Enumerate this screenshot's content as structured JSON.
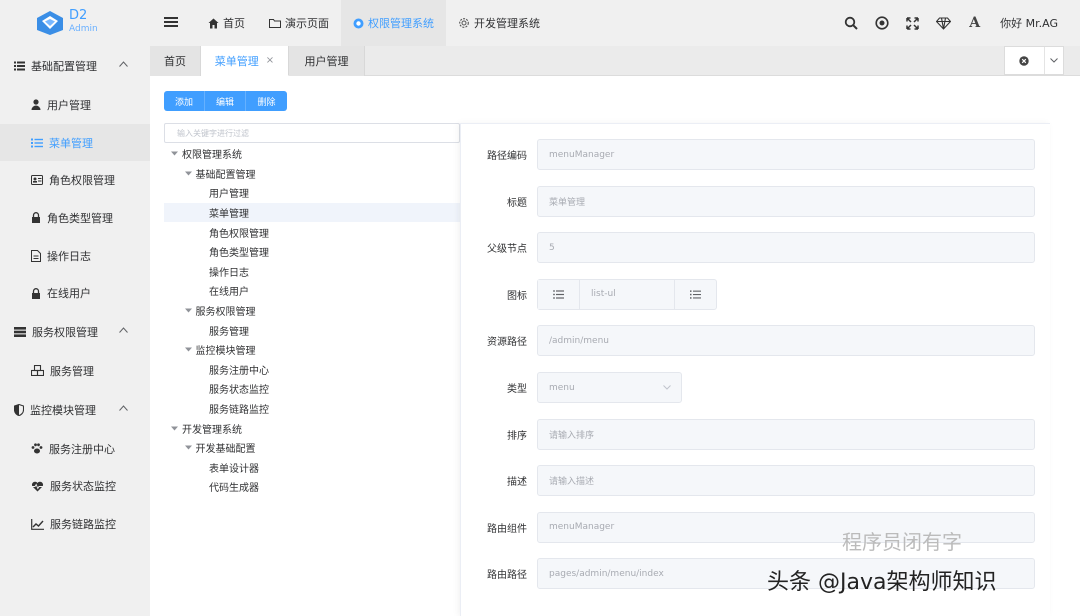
{
  "app": {
    "name": "D2",
    "subtitle": "Admin"
  },
  "topnav": [
    {
      "label": "首页",
      "icon": "home-icon"
    },
    {
      "label": "演示页面",
      "icon": "folder-icon"
    },
    {
      "label": "权限管理系统",
      "icon": "shield-icon",
      "active": true
    },
    {
      "label": "开发管理系统",
      "icon": "gear-icon"
    }
  ],
  "tools": [
    "search-icon",
    "record-icon",
    "fullscreen-icon",
    "diamond-icon",
    "font-icon"
  ],
  "font_tool_label": "A",
  "greeting": "你好 Mr.AG",
  "sidebar": {
    "groups": [
      {
        "label": "基础配置管理",
        "icon": "list-icon",
        "items": [
          {
            "label": "用户管理",
            "icon": "user-icon"
          },
          {
            "label": "菜单管理",
            "icon": "menu-list-icon",
            "active": true
          },
          {
            "label": "角色权限管理",
            "icon": "id-card-icon"
          },
          {
            "label": "角色类型管理",
            "icon": "lock-icon"
          },
          {
            "label": "操作日志",
            "icon": "document-icon"
          },
          {
            "label": "在线用户",
            "icon": "lock-icon"
          }
        ]
      },
      {
        "label": "服务权限管理",
        "icon": "server-icon",
        "items": [
          {
            "label": "服务管理",
            "icon": "cubes-icon"
          }
        ]
      },
      {
        "label": "监控模块管理",
        "icon": "shield-half-icon",
        "items": [
          {
            "label": "服务注册中心",
            "icon": "paw-icon"
          },
          {
            "label": "服务状态监控",
            "icon": "heartbeat-icon"
          },
          {
            "label": "服务链路监控",
            "icon": "line-chart-icon"
          }
        ]
      }
    ]
  },
  "tabs": [
    {
      "label": "首页"
    },
    {
      "label": "菜单管理",
      "active": true,
      "close": "×"
    },
    {
      "label": "用户管理"
    }
  ],
  "toolbar": {
    "add": "添加",
    "edit": "编辑",
    "delete": "删除"
  },
  "tree": {
    "filter_placeholder": "输入关键字进行过滤",
    "nodes": [
      {
        "label": "权限管理系统",
        "level": 0,
        "expanded": true
      },
      {
        "label": "基础配置管理",
        "level": 1,
        "expanded": true
      },
      {
        "label": "用户管理",
        "level": 2
      },
      {
        "label": "菜单管理",
        "level": 2,
        "active": true
      },
      {
        "label": "角色权限管理",
        "level": 2
      },
      {
        "label": "角色类型管理",
        "level": 2
      },
      {
        "label": "操作日志",
        "level": 2
      },
      {
        "label": "在线用户",
        "level": 2
      },
      {
        "label": "服务权限管理",
        "level": 1,
        "expanded": true
      },
      {
        "label": "服务管理",
        "level": 2
      },
      {
        "label": "监控模块管理",
        "level": 1,
        "expanded": true
      },
      {
        "label": "服务注册中心",
        "level": 2
      },
      {
        "label": "服务状态监控",
        "level": 2
      },
      {
        "label": "服务链路监控",
        "level": 2
      },
      {
        "label": "开发管理系统",
        "level": 0,
        "expanded": true
      },
      {
        "label": "开发基础配置",
        "level": 1,
        "expanded": true
      },
      {
        "label": "表单设计器",
        "level": 2
      },
      {
        "label": "代码生成器",
        "level": 2
      }
    ]
  },
  "form": {
    "code": {
      "label": "路径编码",
      "value": "menuManager"
    },
    "title": {
      "label": "标题",
      "value": "菜单管理"
    },
    "parent": {
      "label": "父级节点",
      "value": "5"
    },
    "icon": {
      "label": "图标",
      "value": "list-ul"
    },
    "resource": {
      "label": "资源路径",
      "value": "/admin/menu"
    },
    "type": {
      "label": "类型",
      "value": "menu"
    },
    "order": {
      "label": "排序",
      "placeholder": "请输入排序"
    },
    "desc": {
      "label": "描述",
      "placeholder": "请输入描述"
    },
    "component": {
      "label": "路由组件",
      "value": "menuManager"
    },
    "route": {
      "label": "路由路径",
      "value": "pages/admin/menu/index"
    }
  },
  "watermark": {
    "main": "头条 @Java架构师知识",
    "sub": "程序员闭有字"
  },
  "colors": {
    "accent": "#409eff",
    "header_bg": "#f0f0f0",
    "active_bg": "#e6e6e6"
  }
}
